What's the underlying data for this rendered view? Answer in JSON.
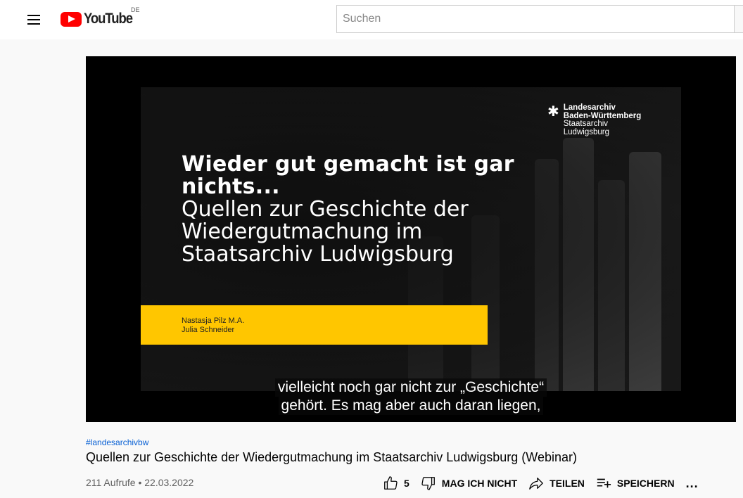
{
  "header": {
    "logo_text": "YouTube",
    "country_code": "DE",
    "search_placeholder": "Suchen"
  },
  "video": {
    "slide": {
      "archive_lines": [
        "Landesarchiv",
        "Baden-Württemberg",
        "Staatsarchiv",
        "Ludwigsburg"
      ],
      "title_bold": [
        "Wieder gut gemacht ist gar",
        "nichts..."
      ],
      "title_light": [
        "Quellen zur Geschichte der",
        "Wiedergutmachung im",
        "Staatsarchiv Ludwigsburg"
      ],
      "authors": [
        "Nastasja Pilz M.A.",
        "Julia Schneider"
      ],
      "accent_color": "#ffc600"
    },
    "captions": [
      "vielleicht noch gar nicht zur „Geschichte“",
      "gehört. Es mag aber auch daran liegen,"
    ]
  },
  "info": {
    "hashtag": "#landesarchivbw",
    "title": "Quellen zur Geschichte der Wiedergutmachung im Staatsarchiv Ludwigsburg (Webinar)",
    "meta": "211 Aufrufe • 22.03.2022",
    "like_count": "5",
    "dislike_label": "MAG ICH NICHT",
    "share_label": "TEILEN",
    "save_label": "SPEICHERN",
    "more_label": "..."
  },
  "colors": {
    "brand_red": "#ff0000",
    "link_blue": "#065fd4"
  }
}
